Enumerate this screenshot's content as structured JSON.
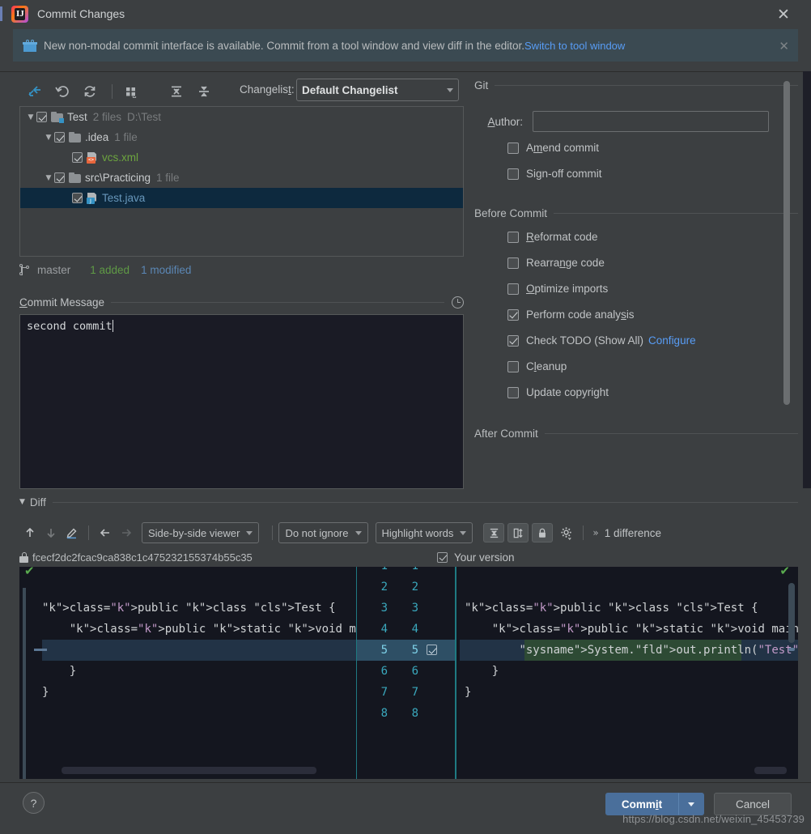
{
  "window": {
    "title": "Commit Changes",
    "close_label": "✕",
    "app_icon_letter": "IJ"
  },
  "banner": {
    "icon": "gift-icon",
    "message": "New non-modal commit interface is available. Commit from a tool window and view diff in the editor.",
    "link": "Switch to tool window",
    "close_label": "✕"
  },
  "toolbar": {
    "icons": [
      "move-to-changelist-icon",
      "rollback-icon",
      "refresh-icon",
      "group-by-icon",
      "expand-all-icon",
      "collapse-all-icon"
    ],
    "changelist_label": "Changelist:",
    "changelist_mnemonic": "t",
    "changelist_value": "Default Changelist"
  },
  "file_tree": {
    "rows": [
      {
        "indent": 0,
        "arrow": "▼",
        "checked": true,
        "icon": "module-folder-icon",
        "name": "Test",
        "name_class": "",
        "meta": "2 files",
        "path": "D:\\Test",
        "selected": false
      },
      {
        "indent": 1,
        "arrow": "▼",
        "checked": true,
        "icon": "folder-icon",
        "name": ".idea",
        "name_class": "",
        "meta": "1 file",
        "path": "",
        "selected": false
      },
      {
        "indent": 2,
        "arrow": "",
        "checked": true,
        "icon": "xml-file-icon",
        "name": "vcs.xml",
        "name_class": "added",
        "meta": "",
        "path": "",
        "selected": false
      },
      {
        "indent": 1,
        "arrow": "▼",
        "checked": true,
        "icon": "folder-icon",
        "name": "src\\Practicing",
        "name_class": "",
        "meta": "1 file",
        "path": "",
        "selected": false
      },
      {
        "indent": 2,
        "arrow": "",
        "checked": true,
        "icon": "java-file-icon",
        "name": "Test.java",
        "name_class": "modified",
        "meta": "",
        "path": "",
        "selected": true
      }
    ]
  },
  "branch_status": {
    "icon": "branch-icon",
    "branch": "master",
    "added": "1 added",
    "modified": "1 modified"
  },
  "commit_message": {
    "title": "Commit Message",
    "mnemonic": "C",
    "history_icon": "history-clock-icon",
    "value": "second commit"
  },
  "git_section": {
    "title": "Git",
    "author_label": "Author:",
    "author_mnemonic": "A",
    "author_value": "",
    "checkboxes": [
      {
        "label_pre": "A",
        "label_mn": "m",
        "label_post": "end commit",
        "checked": false,
        "name": "amend-commit"
      },
      {
        "label_pre": "Si",
        "label_mn": "g",
        "label_post": "n-off commit",
        "checked": false,
        "name": "sign-off-commit"
      }
    ]
  },
  "before_commit": {
    "title": "Before Commit",
    "checkboxes": [
      {
        "label_pre": "",
        "label_mn": "R",
        "label_post": "eformat code",
        "checked": false,
        "name": "reformat-code",
        "link": ""
      },
      {
        "label_pre": "Rearra",
        "label_mn": "n",
        "label_post": "ge code",
        "checked": false,
        "name": "rearrange-code",
        "link": ""
      },
      {
        "label_pre": "",
        "label_mn": "O",
        "label_post": "ptimize imports",
        "checked": false,
        "name": "optimize-imports",
        "link": ""
      },
      {
        "label_pre": "Perform code analy",
        "label_mn": "s",
        "label_post": "is",
        "checked": true,
        "name": "perform-code-analysis",
        "link": ""
      },
      {
        "label_pre": "Check TODO (Show All)",
        "label_mn": "",
        "label_post": "",
        "checked": true,
        "name": "check-todo",
        "link": "Configure"
      },
      {
        "label_pre": "C",
        "label_mn": "l",
        "label_post": "eanup",
        "checked": false,
        "name": "cleanup",
        "link": ""
      },
      {
        "label_pre": "Update copyright",
        "label_mn": "",
        "label_post": "",
        "checked": false,
        "name": "update-copyright",
        "link": ""
      }
    ]
  },
  "after_commit": {
    "title": "After Commit"
  },
  "diff": {
    "section_title": "Diff",
    "section_arrow": "▼",
    "toolbar": {
      "prev_icon": "arrow-up-icon",
      "next_icon": "arrow-down-icon",
      "edit_icon": "edit-pencil-icon",
      "apply_left_icon": "arrow-left-icon",
      "apply_right_icon": "arrow-right-icon",
      "viewer_mode": "Side-by-side viewer",
      "ignore_mode": "Do not ignore",
      "highlight_mode": "Highlight words",
      "collapse_icon": "collapse-unchanged-icon",
      "sync_scroll_icon": "synchronize-scroll-icon",
      "lock_icon": "lock-icon",
      "settings_icon": "gear-icon",
      "more_icon": "chevron-double-right-icon",
      "difference_count": "1 difference"
    },
    "info": {
      "lock_icon": "lock-icon",
      "revision_hash": "fcecf2dc2fcac9ca838c1c475232155374b55c35",
      "your_version_checked": true,
      "your_version_label": "Your version"
    },
    "left_lines": [
      "",
      "",
      "public class Test {",
      "    public static void main(String[] ar",
      "",
      "    }",
      "}",
      ""
    ],
    "right_lines": [
      "",
      "",
      "public class Test {",
      "    public static void main(String[] args",
      "        System.out.println(\"Test\");",
      "    }",
      "}",
      ""
    ],
    "line_numbers_left": [
      "1",
      "2",
      "3",
      "4",
      "5",
      "6",
      "7",
      "8"
    ],
    "line_numbers_right": [
      "1",
      "2",
      "3",
      "4",
      "5",
      "6",
      "7",
      "8"
    ],
    "highlighted_line": "5",
    "accept_checkbox_checked": true
  },
  "footer": {
    "help_label": "?",
    "commit_pre": "Comm",
    "commit_mn": "i",
    "commit_post": "t",
    "commit_dropdown_icon": "chevron-down-icon",
    "cancel_label": "Cancel"
  },
  "watermark": {
    "text": "https://blog.csdn.net/weixin_45453739"
  }
}
